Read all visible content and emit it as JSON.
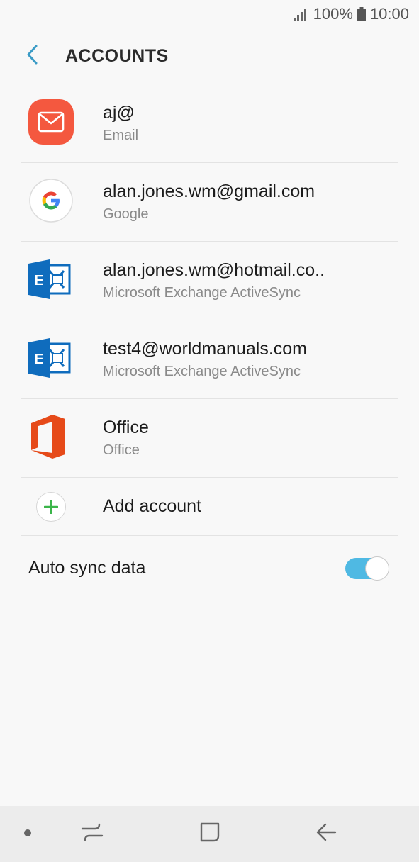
{
  "status_bar": {
    "battery_percent": "100%",
    "time": "10:00"
  },
  "header": {
    "title": "ACCOUNTS",
    "back_icon": "chevron-left-icon"
  },
  "accounts": [
    {
      "primary": "aj@",
      "secondary": "Email",
      "icon": "email-app-icon"
    },
    {
      "primary": "alan.jones.wm@gmail.com",
      "secondary": "Google",
      "icon": "google-icon"
    },
    {
      "primary": "alan.jones.wm@hotmail.co..",
      "secondary": "Microsoft Exchange ActiveSync",
      "icon": "exchange-icon"
    },
    {
      "primary": "test4@worldmanuals.com",
      "secondary": "Microsoft Exchange ActiveSync",
      "icon": "exchange-icon"
    },
    {
      "primary": "Office",
      "secondary": "Office",
      "icon": "office-icon"
    }
  ],
  "add_account": {
    "label": "Add account"
  },
  "auto_sync": {
    "label": "Auto sync data",
    "enabled": true
  },
  "colors": {
    "accent": "#4fb9e3",
    "email_icon": "#f4583f",
    "exchange_blue": "#0f6cbd",
    "office_red": "#e64a19",
    "add_green": "#3bb54a"
  }
}
